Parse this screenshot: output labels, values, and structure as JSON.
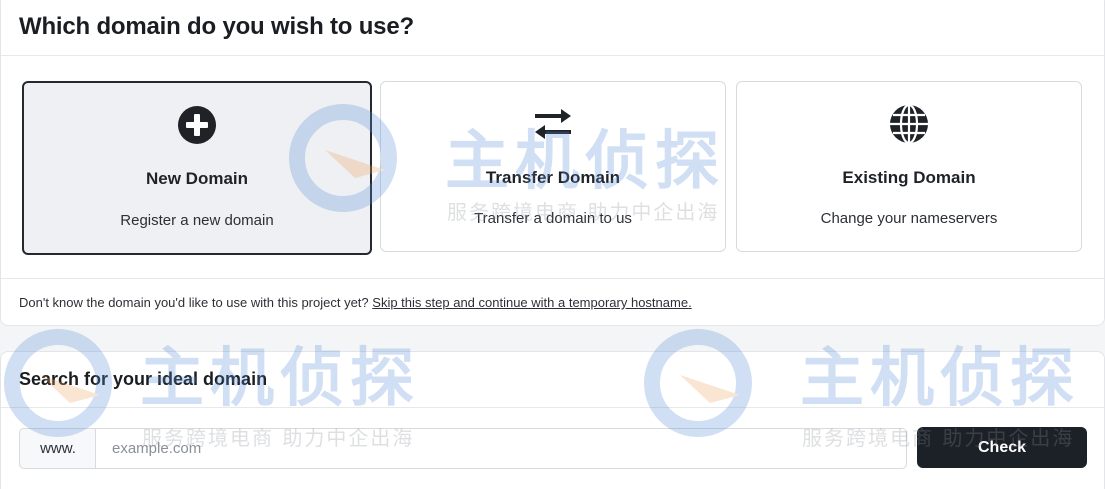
{
  "panel_domain": {
    "title": "Which domain do you wish to use?",
    "options": [
      {
        "icon": "plus-circle-icon",
        "title": "New Domain",
        "description": "Register a new domain",
        "selected": true
      },
      {
        "icon": "transfer-arrows-icon",
        "title": "Transfer Domain",
        "description": "Transfer a domain to us",
        "selected": false
      },
      {
        "icon": "globe-icon",
        "title": "Existing Domain",
        "description": "Change your nameservers",
        "selected": false
      }
    ],
    "footer_text": "Don't know the domain you'd like to use with this project yet?",
    "footer_link": "Skip this step and continue with a temporary hostname."
  },
  "panel_search": {
    "title": "Search for your ideal domain",
    "prefix": "www.",
    "input_value": "",
    "input_placeholder": "example.com",
    "check_label": "Check"
  },
  "watermark": {
    "logo_text": "主机侦探",
    "tagline": "服务跨境电商 助力中企出海"
  },
  "colors": {
    "selected_card_bg": "#eef0f3",
    "selected_card_border": "#25292e",
    "button_bg": "#1c2127",
    "watermark_blue": "#5b8fd9"
  }
}
